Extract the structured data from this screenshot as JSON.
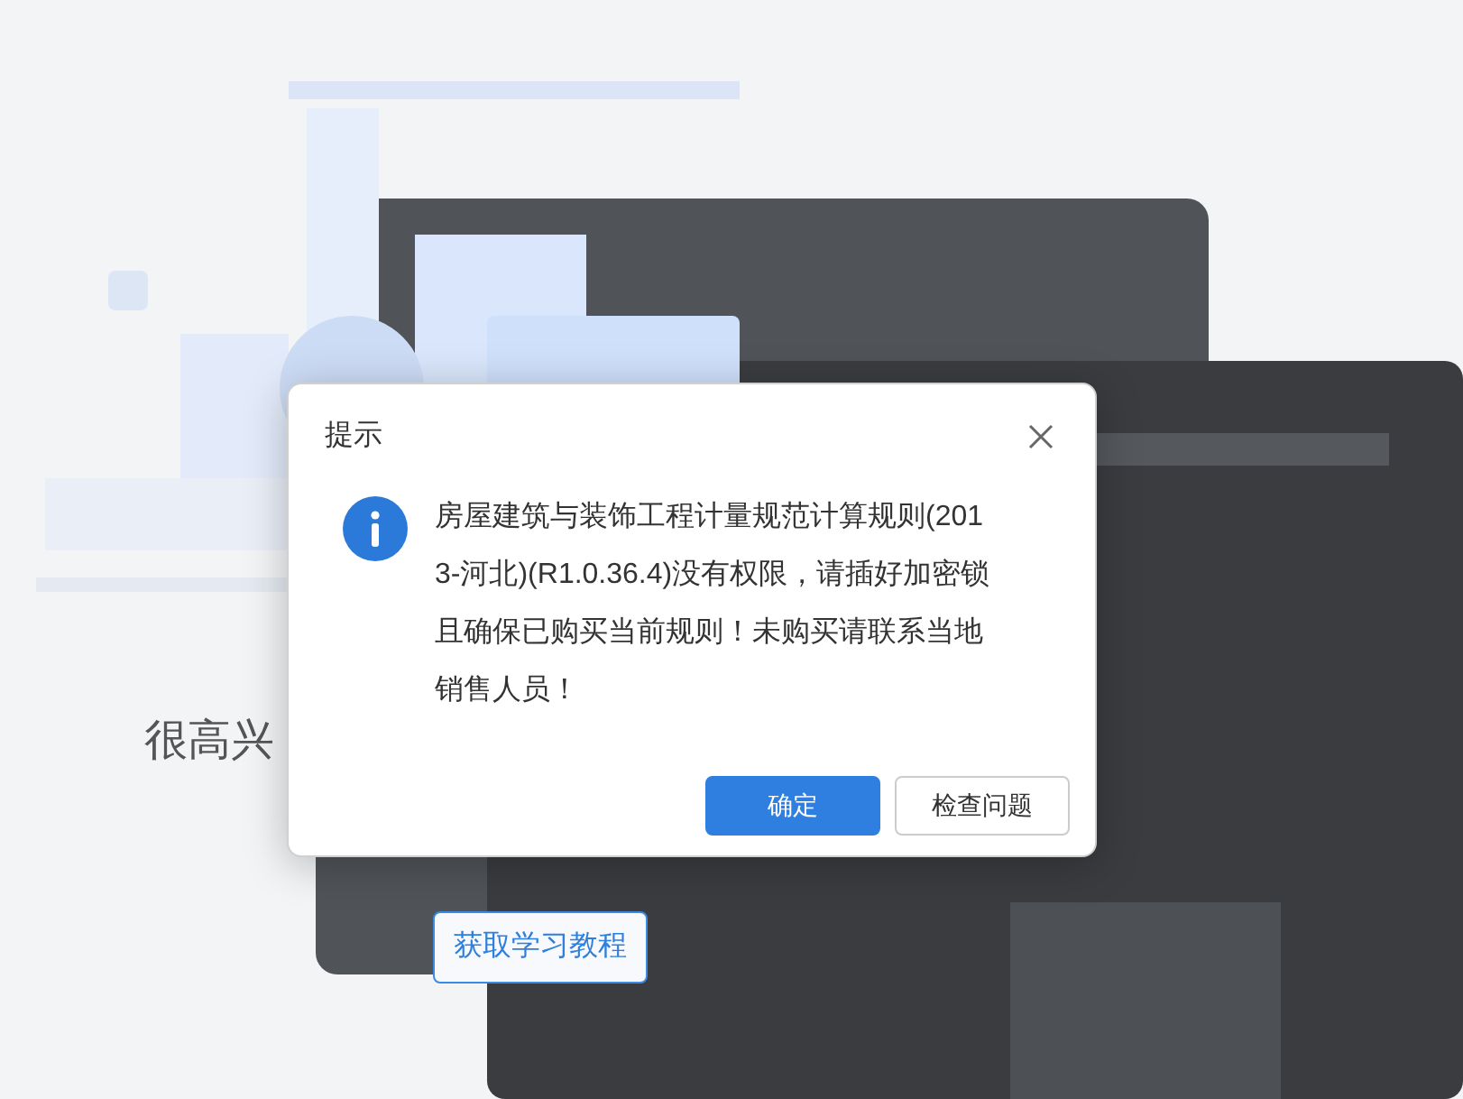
{
  "background": {
    "kind": "picture",
    "greeting": "很高兴",
    "tutorial_button": "获取学习教程"
  },
  "dialog": {
    "title": "提示",
    "message": "房屋建筑与装饰工程计量规范计算规则(2013-河北)(R1.0.36.4)没有权限，请插好加密锁且确保已购买当前规则！未购买请联系当地销售人员！",
    "buttons": [
      {
        "label": "确定",
        "kind": "primary"
      },
      {
        "label": "检查问题",
        "kind": "secondary"
      }
    ]
  }
}
